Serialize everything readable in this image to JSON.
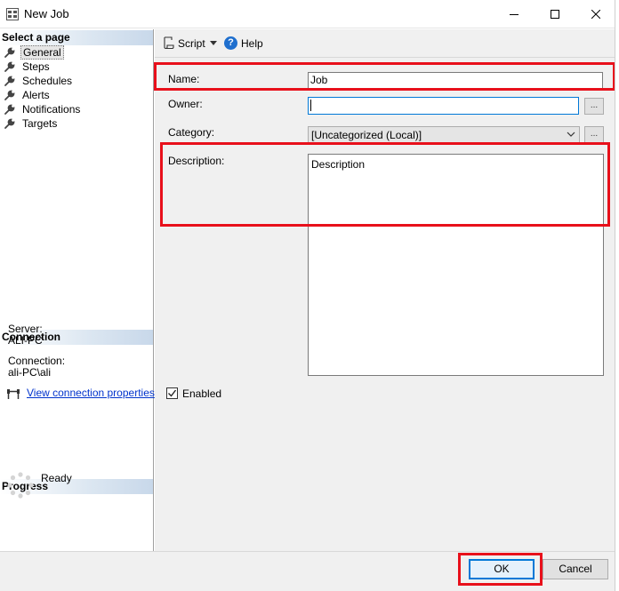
{
  "window": {
    "title": "New Job"
  },
  "left_panel": {
    "select_page_header": "Select a page",
    "pages": [
      {
        "label": "General",
        "selected": true
      },
      {
        "label": "Steps"
      },
      {
        "label": "Schedules"
      },
      {
        "label": "Alerts"
      },
      {
        "label": "Notifications"
      },
      {
        "label": "Targets"
      }
    ],
    "connection": {
      "header": "Connection",
      "server_label": "Server:",
      "server_value": "ALI-PC",
      "connection_label": "Connection:",
      "connection_value": "ali-PC\\ali",
      "properties_link": "View connection properties"
    },
    "progress": {
      "header": "Progress",
      "status": "Ready"
    }
  },
  "toolbar": {
    "script_label": "Script",
    "help_label": "Help"
  },
  "form": {
    "name_label": "Name:",
    "name_value": "Job",
    "owner_label": "Owner:",
    "owner_value": "",
    "category_label": "Category:",
    "category_value": "[Uncategorized (Local)]",
    "description_label": "Description:",
    "description_value": "Description",
    "browse_label": "...",
    "enabled_label": "Enabled",
    "enabled_checked": true
  },
  "buttons": {
    "ok_label": "OK",
    "cancel_label": "Cancel"
  },
  "colors": {
    "highlight": "#e8101b",
    "accent": "#0078d7",
    "link": "#0033cc"
  }
}
